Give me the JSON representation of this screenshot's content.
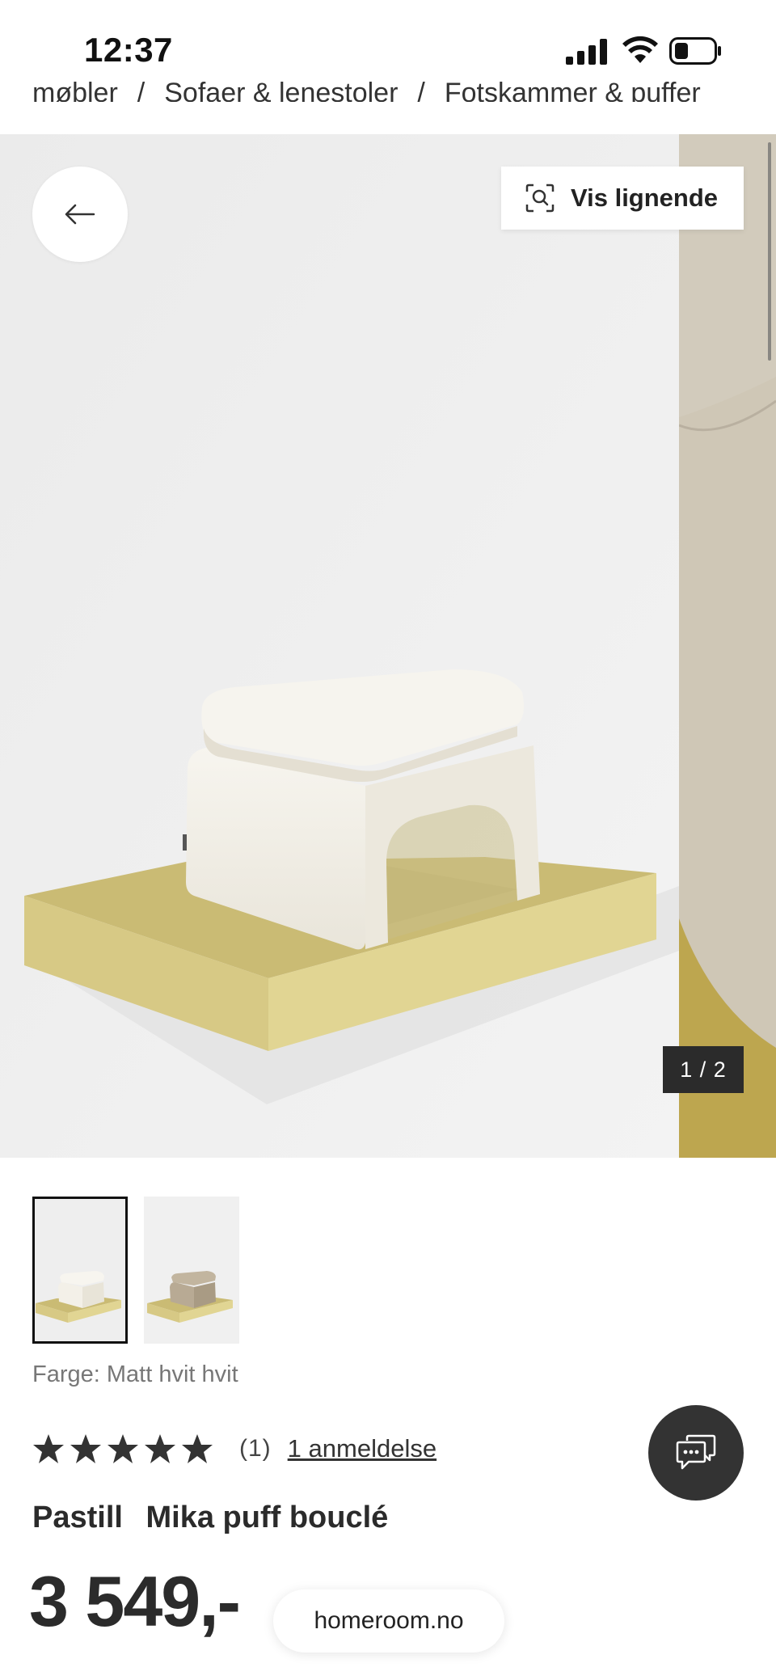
{
  "status_bar": {
    "time": "12:37"
  },
  "breadcrumb": {
    "items": [
      "møbler",
      "Sofaer & lenestoler",
      "Fotskammer & puffer"
    ],
    "separator": "/"
  },
  "gallery": {
    "back_icon": "arrow-left-icon",
    "similar_button": {
      "label": "Vis lignende",
      "icon": "visual-search-icon"
    },
    "counter": "1 / 2",
    "current_index": 1,
    "total": 2
  },
  "thumbnails": [
    {
      "alt": "Mika puff bouclé hvit",
      "active": true
    },
    {
      "alt": "Mika puff bouclé beige",
      "active": false
    }
  ],
  "color": {
    "label": "Farge: Matt hvit hvit"
  },
  "rating": {
    "stars": 5,
    "max_stars": 5,
    "count": "(1)",
    "reviews_link": "1 anmeldelse"
  },
  "product": {
    "brand": "Pastill",
    "name": "Mika puff bouclé"
  },
  "price": "3 549,-",
  "domain": "homeroom.no",
  "colors": {
    "gold_plinth": "#d2c37e",
    "boucle_white": "#f4f1e9",
    "background": "#ececec",
    "dark": "#2b2b2b"
  }
}
